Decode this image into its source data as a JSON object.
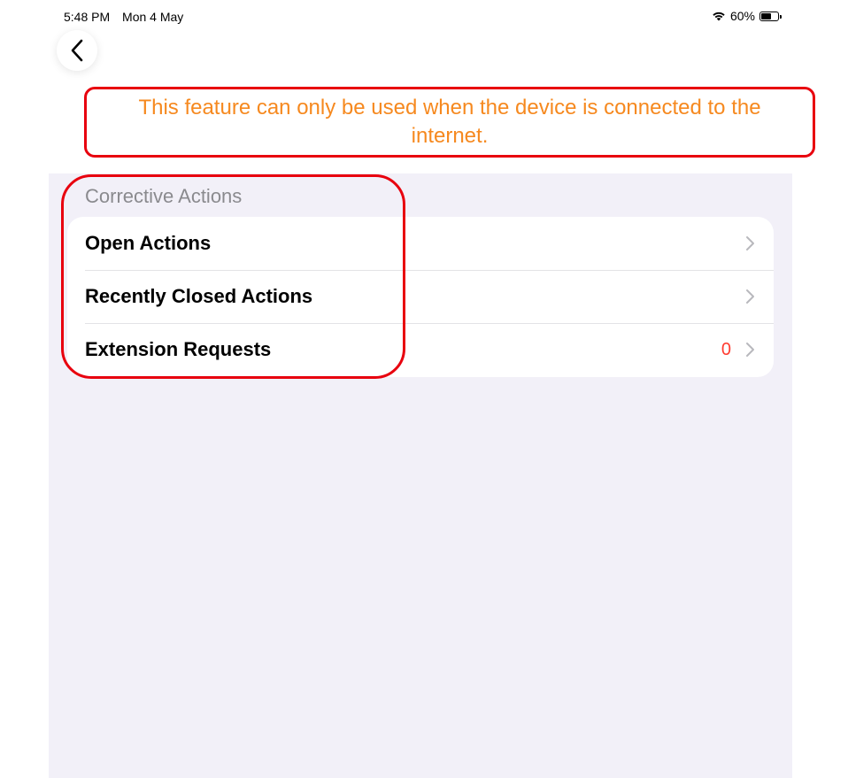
{
  "status_bar": {
    "time": "5:48 PM",
    "date": "Mon 4 May",
    "battery_percent": "60%",
    "battery_level": 0.6
  },
  "banner": {
    "text": "This feature can only be used when the device is connected to the internet.",
    "text_color": "#f6891f",
    "border_color": "#e8000e"
  },
  "section": {
    "header": "Corrective Actions",
    "items": [
      {
        "label": "Open Actions",
        "count": ""
      },
      {
        "label": "Recently Closed Actions",
        "count": ""
      },
      {
        "label": "Extension Requests",
        "count": "0"
      }
    ]
  },
  "colors": {
    "background": "#f2f0f8",
    "count_color": "#ff3b30",
    "annotation_color": "#e8000e"
  },
  "icons": {
    "back": "chevron-left-icon",
    "row": "chevron-right-icon",
    "wifi": "wifi-icon",
    "battery": "battery-icon"
  }
}
